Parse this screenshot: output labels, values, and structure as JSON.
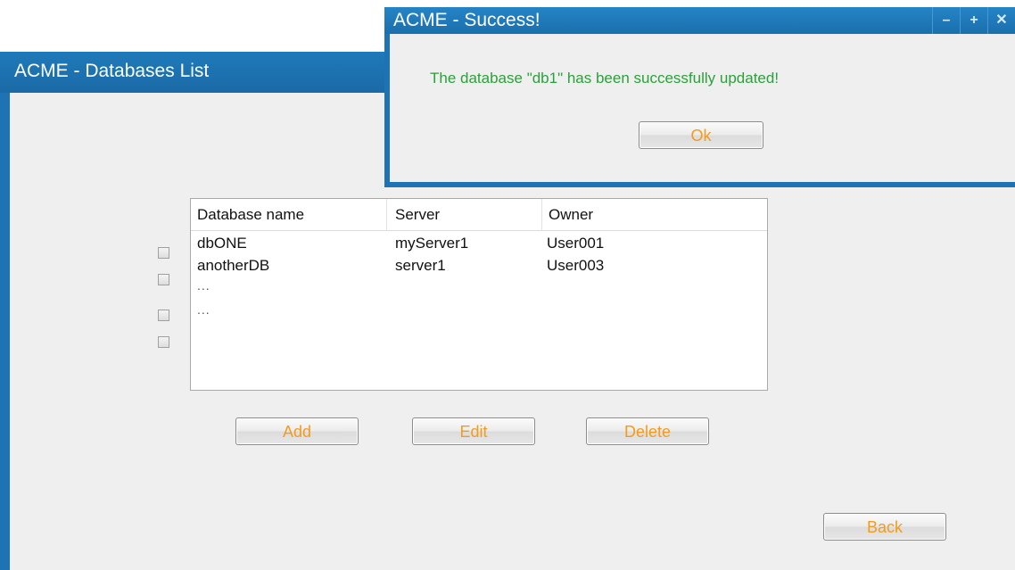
{
  "main_window": {
    "title": "ACME - Databases List",
    "table": {
      "columns": [
        "Database name",
        "Server",
        "Owner"
      ],
      "rows": [
        [
          "dbONE",
          "myServer1",
          "User001"
        ],
        [
          "anotherDB",
          "server1",
          "User003"
        ],
        [
          "...",
          "",
          ""
        ],
        [
          "...",
          "",
          ""
        ]
      ]
    },
    "buttons": {
      "add": "Add",
      "edit": "Edit",
      "delete": "Delete",
      "back": "Back"
    }
  },
  "dialog": {
    "title": "ACME - Success!",
    "message": "The database \"db1\" has been successfully updated!",
    "ok_label": "Ok",
    "controls": {
      "minimize_icon": "minimize-icon",
      "maximize_icon": "maximize-icon",
      "close_icon": "close-icon"
    }
  },
  "colors": {
    "window_frame": "#1e73b4",
    "button_text": "#f29b1d",
    "success_text": "#2aa13a"
  }
}
